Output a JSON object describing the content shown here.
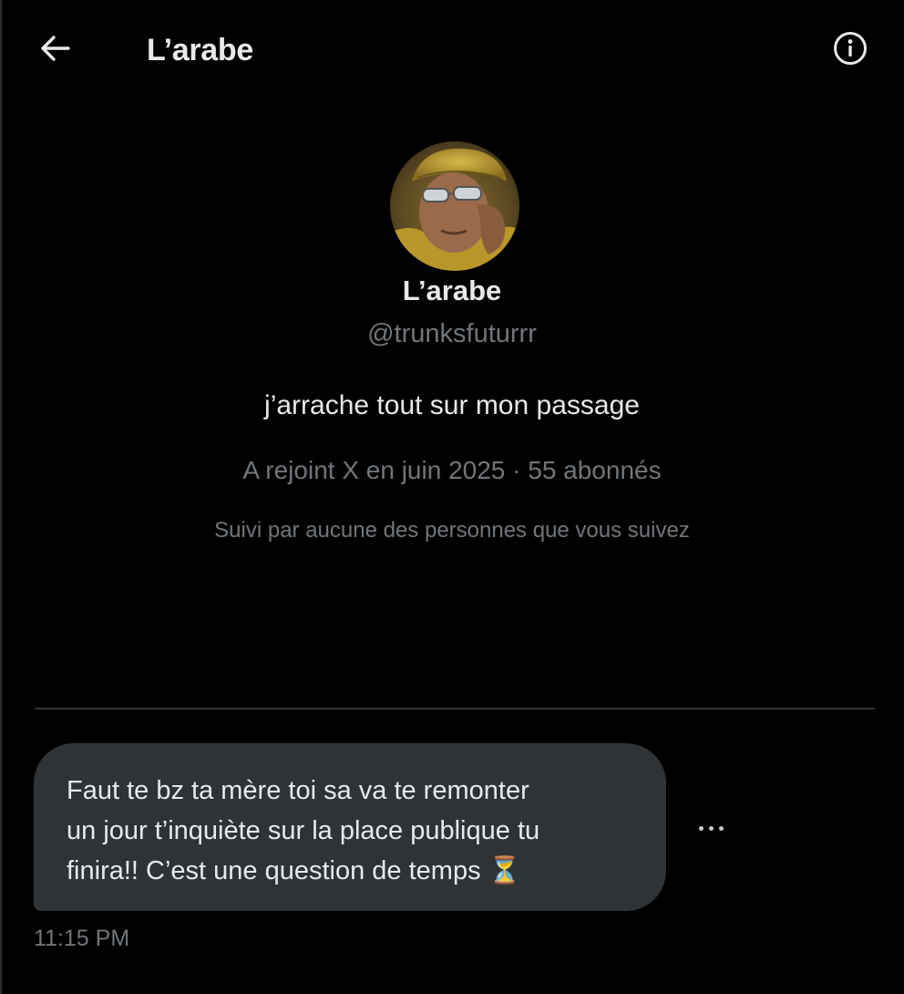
{
  "header": {
    "title": "L’arabe",
    "back_icon": "arrow-left-icon",
    "info_icon": "info-circle-icon"
  },
  "profile": {
    "name": "L’arabe",
    "handle": "@trunksfuturrr",
    "bio": "j’arrache tout sur mon passage",
    "meta": "A rejoint X en juin 2025 · 55 abonnés",
    "followed_by": "Suivi par aucune des personnes que vous suivez"
  },
  "message": {
    "text": "Faut te bz ta mère toi sa va te remonter\nun jour t’inquiète sur la place publique tu\nfinira!! C’est une question de temps ⏳",
    "timestamp": "11:15 PM",
    "more_icon": "more-horizontal-icon"
  },
  "colors": {
    "background": "#000000",
    "primary_text": "#e7e9ea",
    "secondary_text": "#71767b",
    "bubble": "#2f3336",
    "divider": "#2f3336"
  }
}
